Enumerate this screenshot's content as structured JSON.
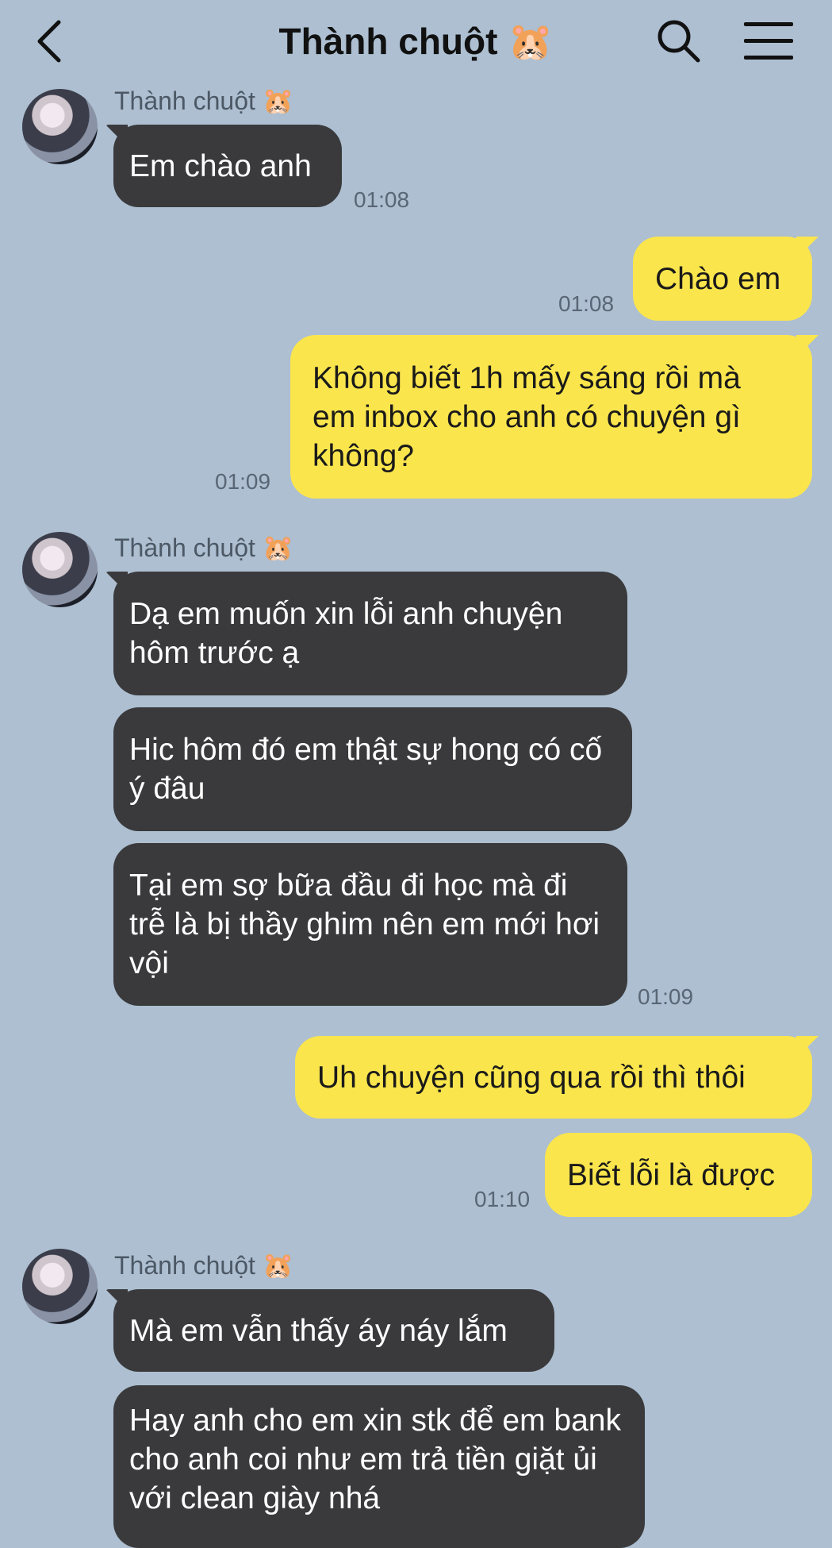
{
  "header": {
    "title": "Thành chuột 🐹",
    "back_icon": "chevron-left-icon",
    "search_icon": "search-icon",
    "menu_icon": "hamburger-menu-icon"
  },
  "colors": {
    "background": "#adbfd1",
    "incoming_bubble": "#3a3a3c",
    "outgoing_bubble": "#fae54d"
  },
  "messages": [
    {
      "direction": "in",
      "sender": "Thành chuột 🐹",
      "text": "Em chào anh",
      "time": "01:08"
    },
    {
      "direction": "out",
      "text": "Chào em",
      "time": "01:08"
    },
    {
      "direction": "out",
      "text": "Không biết 1h mấy sáng rồi mà em inbox cho anh có chuyện gì không?",
      "time": "01:09"
    },
    {
      "direction": "in",
      "sender": "Thành chuột 🐹",
      "text": "Dạ em muốn xin lỗi anh chuyện hôm trước ạ"
    },
    {
      "direction": "in",
      "text": "Hic hôm đó em thật sự hong có cố ý đâu"
    },
    {
      "direction": "in",
      "text": "Tại em sợ bữa đầu đi học mà đi trễ là bị thầy ghim nên em mới hơi vội",
      "time": "01:09"
    },
    {
      "direction": "out",
      "text": "Uh chuyện cũng qua rồi thì thôi"
    },
    {
      "direction": "out",
      "text": "Biết lỗi là được",
      "time": "01:10"
    },
    {
      "direction": "in",
      "sender": "Thành chuột 🐹",
      "text": "Mà em vẫn thấy áy náy lắm"
    },
    {
      "direction": "in",
      "text": "Hay anh cho em xin stk để em bank cho anh coi như em trả tiền giặt ủi với clean giày nhá"
    }
  ]
}
